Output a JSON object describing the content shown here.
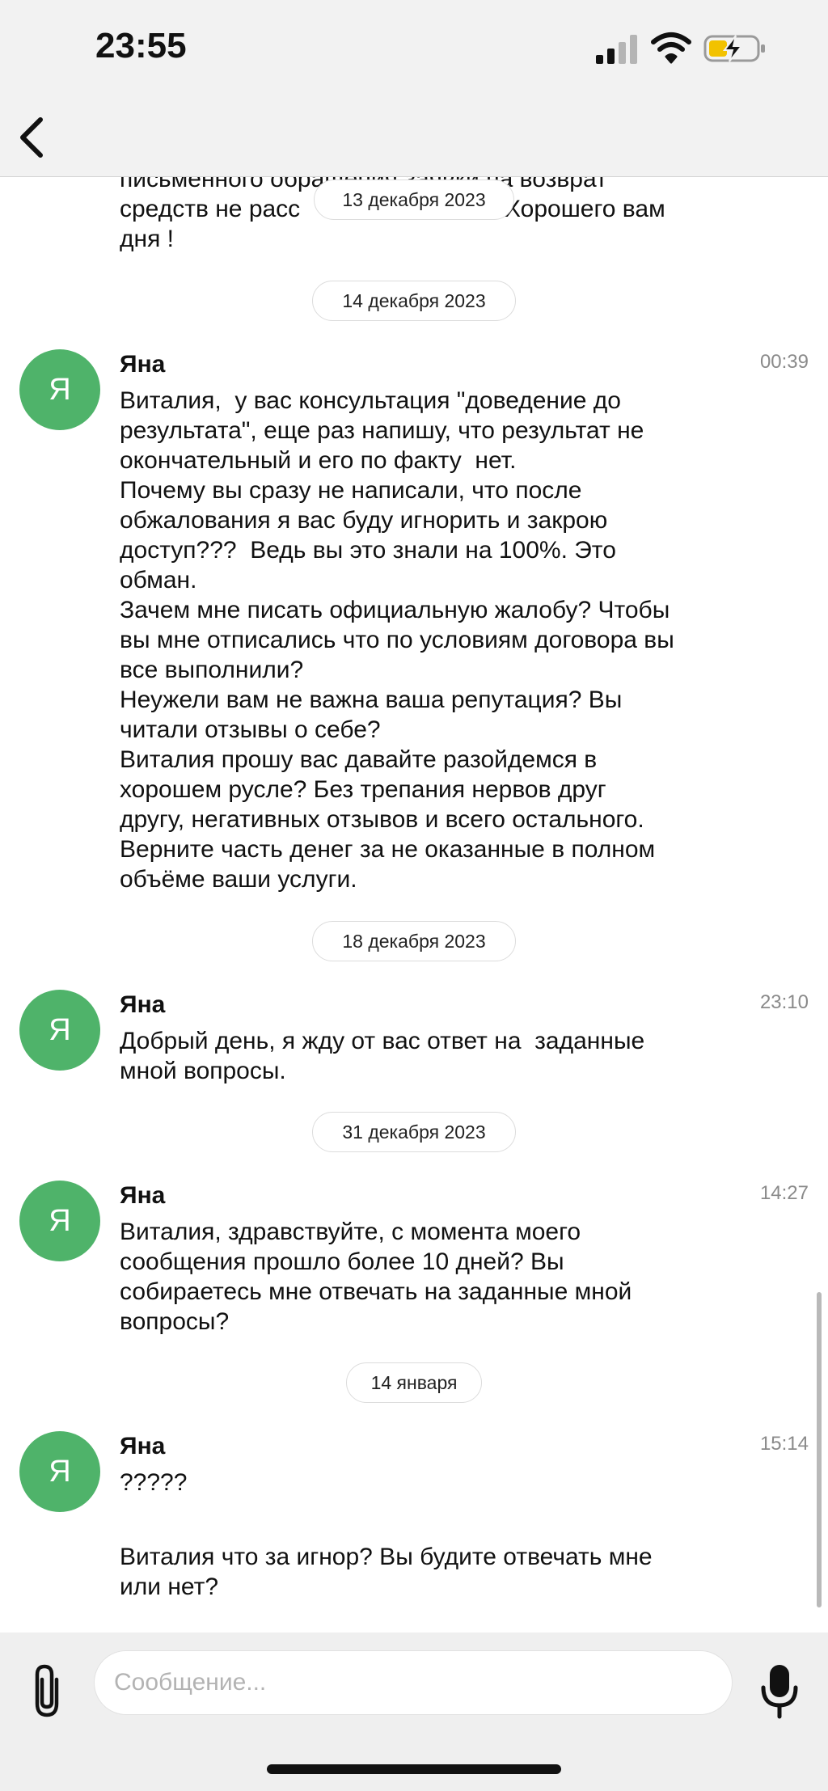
{
  "status_bar": {
    "time": "23:55"
  },
  "chat": {
    "partial_message": {
      "line1": "письменного обращения заявки на возврат",
      "line2_start": "средств не расс",
      "line2_end": "Хорошего вам",
      "line3": "дня !"
    },
    "sticky_date": "13 декабря 2023",
    "dates": [
      "14 декабря 2023",
      "18 декабря 2023",
      "31 декабря 2023",
      "14 января"
    ],
    "messages": [
      {
        "avatar": "Я",
        "sender": "Яна",
        "time": "00:39",
        "text": "Виталия,  у вас консультация \"доведение до\nрезультата\", еще раз напишу, что результат не\nокончательный и его по факту  нет.\nПочему вы сразу не написали, что после\nобжалования я вас буду игнорить и закрою\nдоступ???  Ведь вы это знали на 100%. Это\nобман.\nЗачем мне писать официальную жалобу? Чтобы\nвы мне отписались что по условиям договора вы\nвсе выполнили?\nНеужели вам не важна ваша репутация? Вы\nчитали отзывы о себе?\nВиталия прошу вас давайте разойдемся в\nхорошем русле? Без трепания нервов друг\nдругу, негативных отзывов и всего остального.\nВерните часть денег за не оказанные в полном\nобъёме ваши услуги."
      },
      {
        "avatar": "Я",
        "sender": "Яна",
        "time": "23:10",
        "text": "Добрый день, я жду от вас ответ на  заданные\nмной вопросы."
      },
      {
        "avatar": "Я",
        "sender": "Яна",
        "time": "14:27",
        "text": "Виталия, здравствуйте, с момента моего\nсообщения прошло более 10 дней? Вы\nсобираетесь мне отвечать на заданные мной\nвопросы?"
      },
      {
        "avatar": "Я",
        "sender": "Яна",
        "time": "15:14",
        "text": "?????",
        "text2": "Виталия что за игнор? Вы будите отвечать мне\nили нет?"
      }
    ]
  },
  "input": {
    "placeholder": "Сообщение..."
  },
  "colors": {
    "avatar": "#4fb36a",
    "bars": "#f2f2f2"
  },
  "icons": [
    "back-icon",
    "signal-icon",
    "wifi-icon",
    "battery-charging-icon",
    "paperclip-icon",
    "microphone-icon"
  ]
}
